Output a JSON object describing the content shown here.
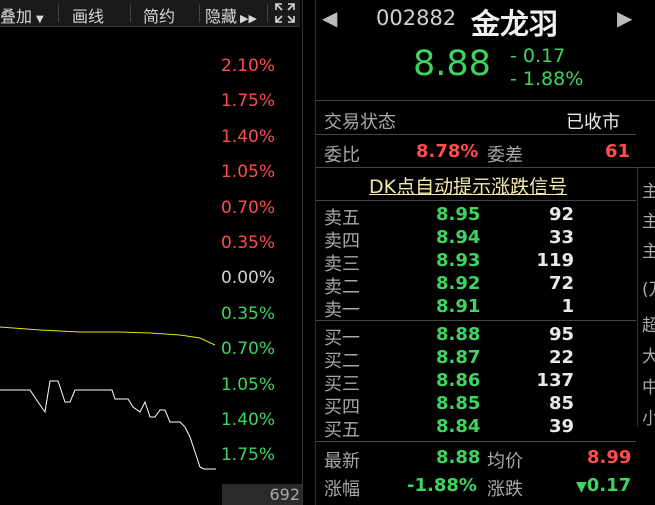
{
  "toolbar": {
    "overlay_label": "叠加",
    "draw_label": "画线",
    "simple_label": "简约",
    "hide_label": "隐藏"
  },
  "chart": {
    "pct_labels": [
      {
        "text": "2.10%",
        "color": "#ff4d4d"
      },
      {
        "text": "1.75%",
        "color": "#ff4d4d"
      },
      {
        "text": "1.40%",
        "color": "#ff4d4d"
      },
      {
        "text": "1.05%",
        "color": "#ff4d4d"
      },
      {
        "text": "0.70%",
        "color": "#ff4d4d"
      },
      {
        "text": "0.35%",
        "color": "#ff4d4d"
      },
      {
        "text": "0.00%",
        "color": "#d0d0d0"
      },
      {
        "text": "0.35%",
        "color": "#3fd35f"
      },
      {
        "text": "0.70%",
        "color": "#3fd35f"
      },
      {
        "text": "1.05%",
        "color": "#3fd35f"
      },
      {
        "text": "1.40%",
        "color": "#3fd35f"
      },
      {
        "text": "1.75%",
        "color": "#3fd35f"
      }
    ],
    "volume_label": "692"
  },
  "quote": {
    "code": "002882",
    "name": "金龙羽",
    "price": "8.88",
    "change": "- 0.17",
    "change_pct": "- 1.88%",
    "status_label": "交易状态",
    "status_value": "已收市",
    "weibi_label": "委比",
    "weibi_value": "8.78%",
    "weicha_label": "委差",
    "weicha_value": "61",
    "dk_signal": "DK点自动提示涨跌信号"
  },
  "asks": [
    {
      "label": "卖五",
      "price": "8.95",
      "vol": "92"
    },
    {
      "label": "卖四",
      "price": "8.94",
      "vol": "33"
    },
    {
      "label": "卖三",
      "price": "8.93",
      "vol": "119"
    },
    {
      "label": "卖二",
      "price": "8.92",
      "vol": "72"
    },
    {
      "label": "卖一",
      "price": "8.91",
      "vol": "1"
    }
  ],
  "bids": [
    {
      "label": "买一",
      "price": "8.88",
      "vol": "95"
    },
    {
      "label": "买二",
      "price": "8.87",
      "vol": "22"
    },
    {
      "label": "买三",
      "price": "8.86",
      "vol": "137"
    },
    {
      "label": "买四",
      "price": "8.85",
      "vol": "85"
    },
    {
      "label": "买五",
      "price": "8.84",
      "vol": "39"
    }
  ],
  "stats": {
    "latest_label": "最新",
    "latest_value": "8.88",
    "avg_label": "均价",
    "avg_value": "8.99",
    "pct_label": "涨幅",
    "pct_value": "-1.88%",
    "chg_label": "涨跌",
    "chg_value": "0.17"
  },
  "side_chars": [
    "主",
    "主",
    "主",
    "(万",
    "超",
    "大",
    "中",
    "小"
  ],
  "colors": {
    "up": "#ff4d4d",
    "down": "#3fd35f",
    "avg_line": "#e6e600",
    "price_line": "#ffffff",
    "signal": "#f5e9a8"
  }
}
